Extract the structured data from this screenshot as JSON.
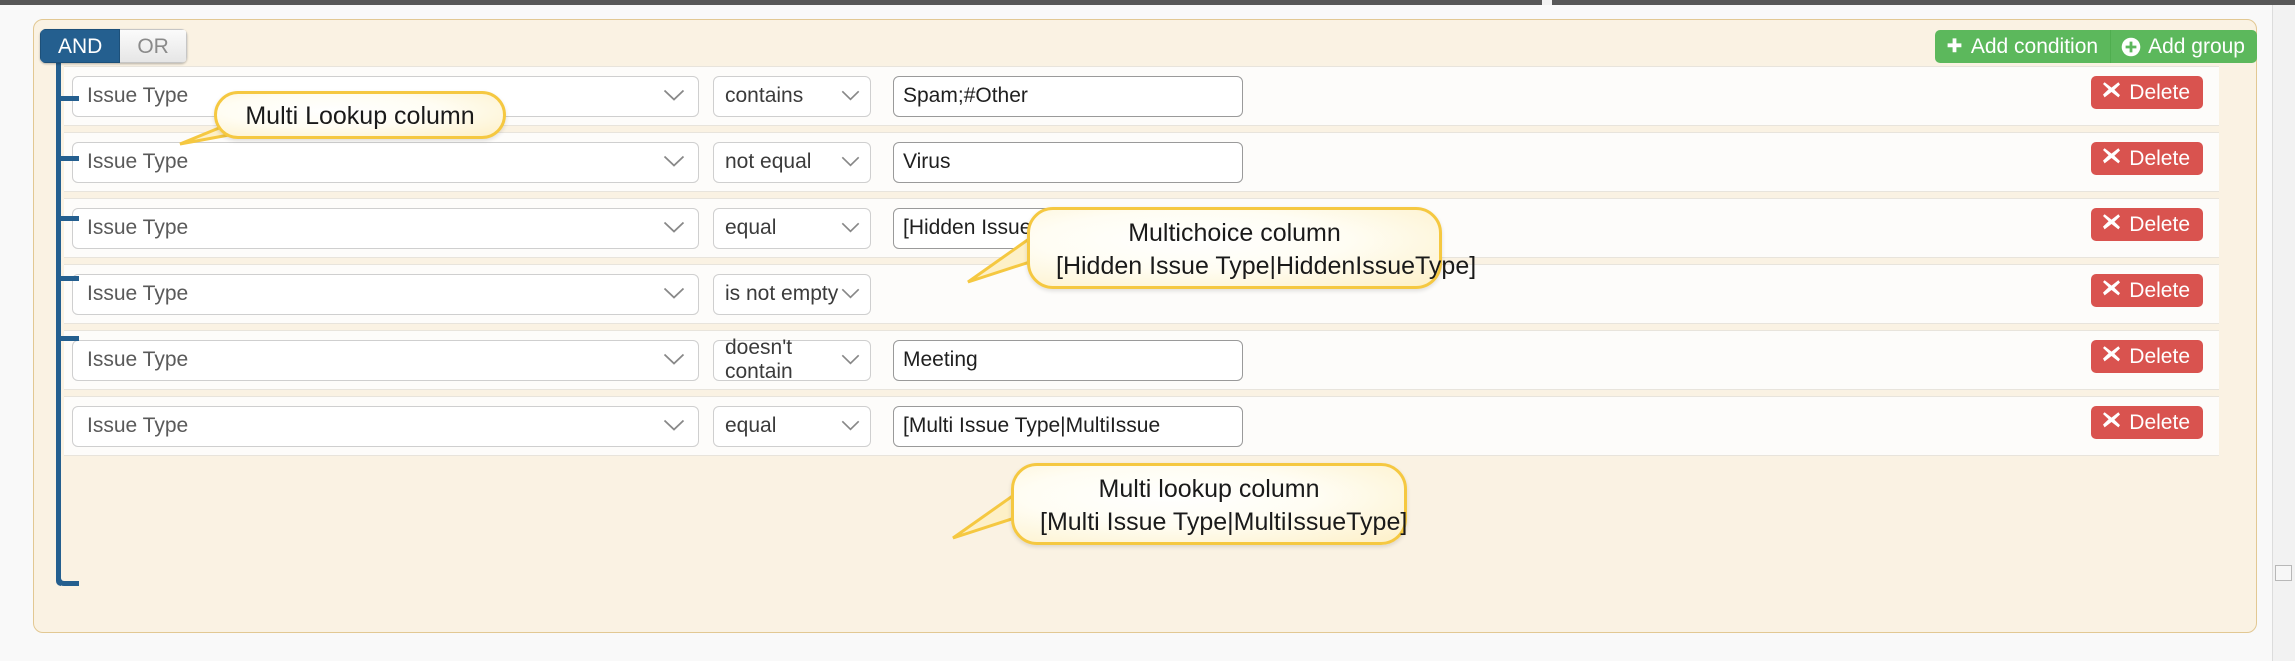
{
  "logic": {
    "and_label": "AND",
    "or_label": "OR",
    "active": "AND"
  },
  "toolbar": {
    "add_condition_label": "Add condition",
    "add_group_label": "Add group",
    "add_button_color": "#5cb85c"
  },
  "delete": {
    "label": "Delete",
    "color": "#d9534f"
  },
  "conditions": [
    {
      "field": "Issue Type",
      "operator": "contains",
      "value": "Spam;#Other",
      "has_value": true
    },
    {
      "field": "Issue Type",
      "operator": "not equal",
      "value": "Virus",
      "has_value": true
    },
    {
      "field": "Issue Type",
      "operator": "equal",
      "value": "[Hidden Issue Type|HiddenI",
      "has_value": true
    },
    {
      "field": "Issue Type",
      "operator": "is not empty",
      "value": "",
      "has_value": false
    },
    {
      "field": "Issue Type",
      "operator": "doesn't contain",
      "value": "Meeting",
      "has_value": true
    },
    {
      "field": "Issue Type",
      "operator": "equal",
      "value": "[Multi Issue Type|MultiIssue",
      "has_value": true
    }
  ],
  "callouts": [
    {
      "line1": "Multi Lookup column",
      "line2": ""
    },
    {
      "line1": "Multichoice column",
      "line2": "[Hidden Issue Type|HiddenIssueType]"
    },
    {
      "line1": "Multi lookup column",
      "line2": "[Multi Issue Type|MultiIssueType]"
    }
  ]
}
